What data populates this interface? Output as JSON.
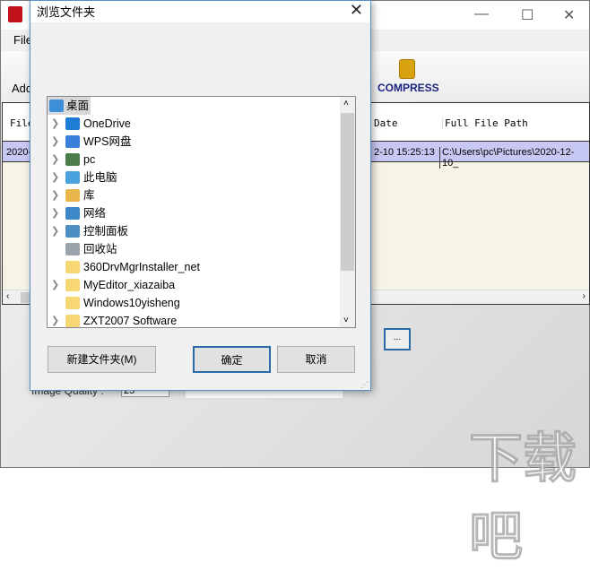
{
  "app": {
    "menu": "File",
    "toolbar_add": "Add",
    "compress_label": "COMPRESS",
    "columns": [
      "File",
      "Date",
      "Full File Path"
    ],
    "row": {
      "file": "2020-",
      "date": "2-10 15:25:13",
      "path": "C:\\Users\\pc\\Pictures\\2020-12-10_"
    },
    "browse_label": "...",
    "quality_label": "Image Quality :",
    "quality_value": "25"
  },
  "dialog": {
    "title": "浏览文件夹",
    "close": "✕",
    "items": [
      {
        "label": "桌面",
        "icon": "desktop-icon",
        "color": "#3c8fd8",
        "expandable": false,
        "selected": true
      },
      {
        "label": "OneDrive",
        "icon": "cloud-icon",
        "color": "#1e7bd6",
        "expandable": true
      },
      {
        "label": "WPS网盘",
        "icon": "cloud-icon",
        "color": "#3a7fd9",
        "expandable": true
      },
      {
        "label": "pc",
        "icon": "user-icon",
        "color": "#4a7d4a",
        "expandable": true
      },
      {
        "label": "此电脑",
        "icon": "computer-icon",
        "color": "#4aa3df",
        "expandable": true
      },
      {
        "label": "库",
        "icon": "library-icon",
        "color": "#e8b64a",
        "expandable": true
      },
      {
        "label": "网络",
        "icon": "network-icon",
        "color": "#3d88c9",
        "expandable": true
      },
      {
        "label": "控制面板",
        "icon": "control-panel-icon",
        "color": "#4b8fc3",
        "expandable": true
      },
      {
        "label": "回收站",
        "icon": "recycle-bin-icon",
        "color": "#9aa4ad",
        "expandable": false
      },
      {
        "label": "360DrvMgrInstaller_net",
        "icon": "folder-icon",
        "color": "#f7d774",
        "expandable": false
      },
      {
        "label": "MyEditor_xiazaiba",
        "icon": "folder-icon",
        "color": "#f7d774",
        "expandable": true
      },
      {
        "label": "Windows10yisheng",
        "icon": "folder-icon",
        "color": "#f7d774",
        "expandable": false
      },
      {
        "label": "ZXT2007 Software",
        "icon": "folder-icon",
        "color": "#f7d774",
        "expandable": true
      }
    ],
    "new_folder": "新建文件夹(M)",
    "ok": "确定",
    "cancel": "取消"
  },
  "watermark": "下载吧"
}
